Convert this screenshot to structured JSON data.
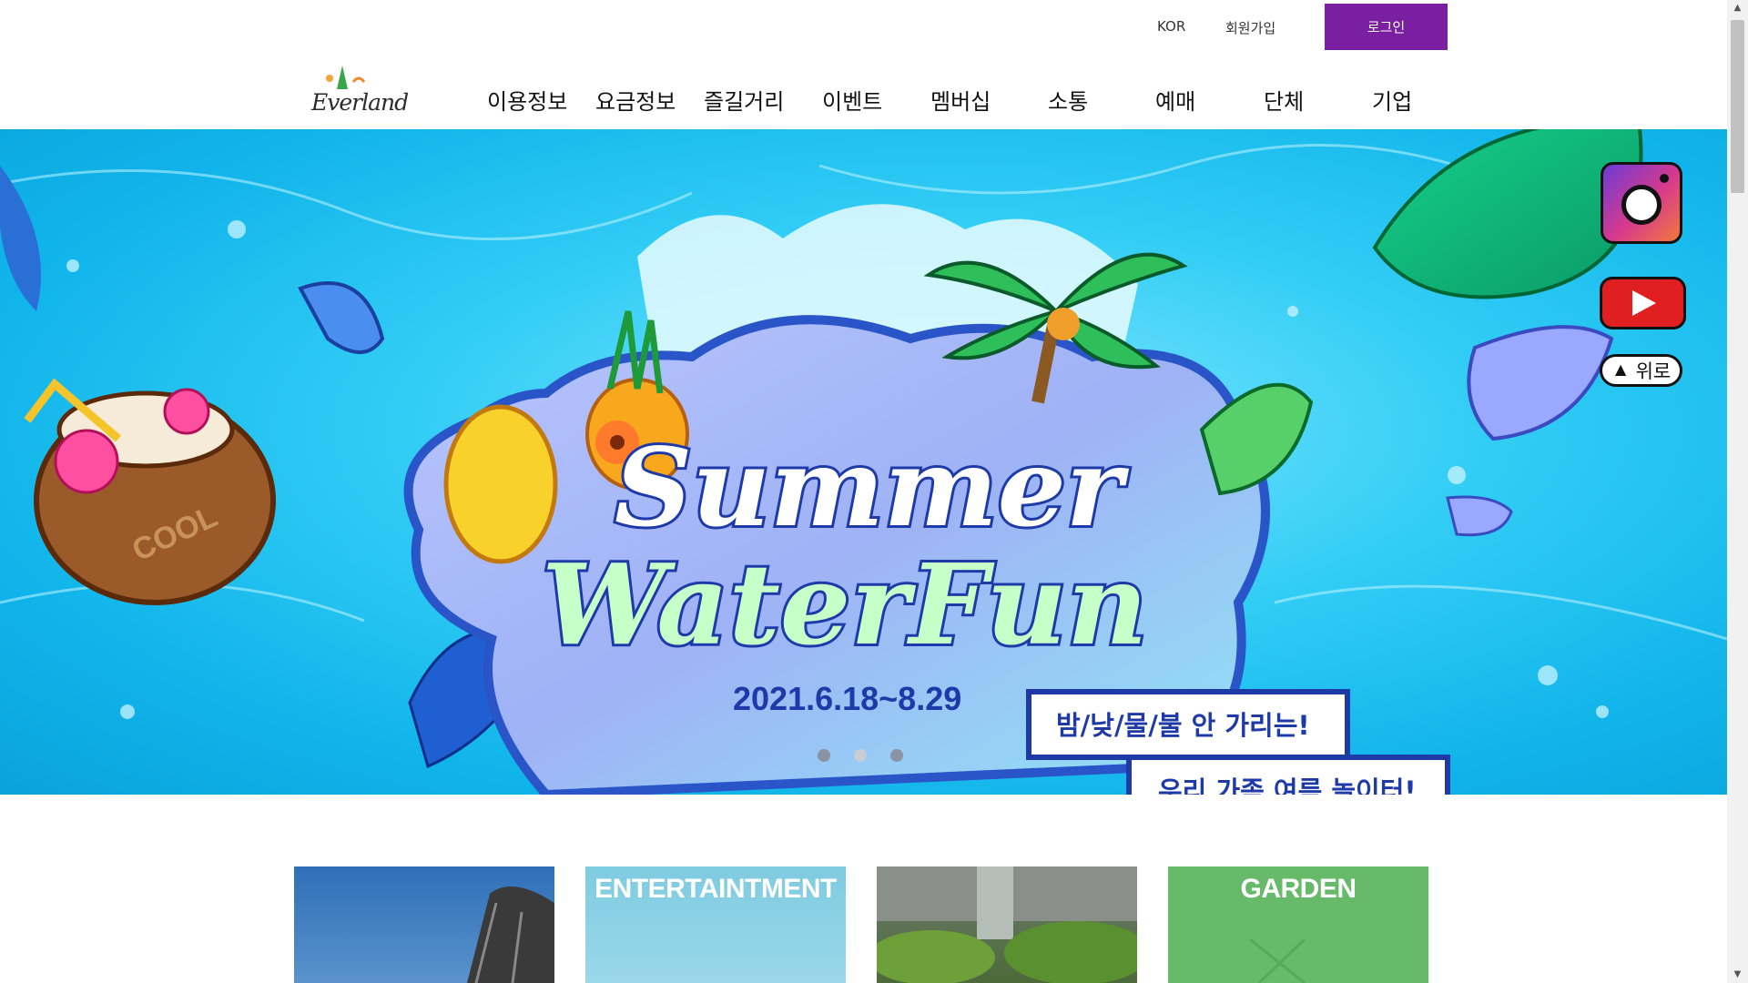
{
  "util_nav": {
    "language": "KOR",
    "join": "회원가입",
    "login": "로그인"
  },
  "logo": {
    "text": "Everland"
  },
  "gnb": {
    "items": [
      "이용정보",
      "요금정보",
      "즐길거리",
      "이벤트",
      "멤버십",
      "소통",
      "예매",
      "단체",
      "기업"
    ]
  },
  "hero": {
    "title_line1": "Summer",
    "title_line2": "WaterFun",
    "dates": "2021.6.18~8.29",
    "tagline1": "밤/낮/물/불 안 가리는!",
    "tagline2": "우리 가족 여름 놀이터!",
    "coconut_text": "COOL",
    "slides": 3,
    "active_slide": 2
  },
  "side": {
    "instagram": "instagram-icon",
    "youtube": "youtube-icon",
    "top_label": "위로"
  },
  "cards": [
    {
      "title": "",
      "color": "#3a6fb0"
    },
    {
      "title": "ENTERTAINTMENT",
      "color": "#8bd3e6"
    },
    {
      "title": "",
      "color": "#5a7a4a"
    },
    {
      "title": "GARDEN",
      "color": "#66ba6a"
    }
  ],
  "colors": {
    "brand": "#7a1fa2",
    "hero_water": "#32cdf5"
  }
}
